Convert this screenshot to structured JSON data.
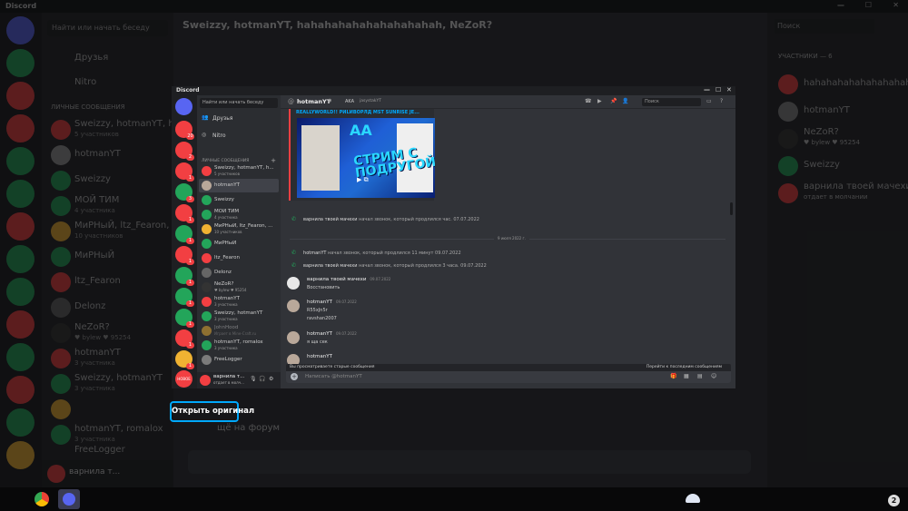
{
  "background": {
    "app_title": "Discord",
    "search_placeholder": "Найти или начать беседу",
    "header_title": "Sweizzy, hotmanYT, hahahahahahahahahahah, NeZoR?",
    "members_header": "УЧАСТНИКИ — 6",
    "search_label": "Поиск",
    "nav": [
      "Друзья",
      "Nitro"
    ],
    "dm_header": "ЛИЧНЫЕ СООБЩЕНИЯ",
    "dms": [
      {
        "name": "Sweizzy, hotmanYT, haha...",
        "sub": "5 участников"
      },
      {
        "name": "hotmanYT",
        "sub": ""
      },
      {
        "name": "Sweizzy",
        "sub": ""
      },
      {
        "name": "МОЙ ТИМ",
        "sub": "4 участника"
      },
      {
        "name": "МиРНыЙ, ltz_Fearon, ...",
        "sub": "10 участников"
      },
      {
        "name": "МиРНыЙ",
        "sub": ""
      },
      {
        "name": "ltz_Fearon",
        "sub": ""
      },
      {
        "name": "Delonz",
        "sub": ""
      },
      {
        "name": "NeZoR?",
        "sub": "♥ bylew ♥ 95254"
      },
      {
        "name": "hotmanYT",
        "sub": "3 участника"
      },
      {
        "name": "Sweizzy, hotmanYT",
        "sub": "3 участника"
      },
      {
        "name": "",
        "sub": ""
      },
      {
        "name": "hotmanYT, romalox",
        "sub": "3 участника"
      },
      {
        "name": "FreeLogger",
        "sub": ""
      }
    ],
    "members": [
      "hahahahahahahahahahah",
      "hotmanYT",
      "NeZoR?",
      "Sweizzy",
      "варнила твоей мачехи"
    ],
    "members_sub": [
      "",
      "",
      "♥ bylew ♥ 95254",
      "",
      "отдает в молчании"
    ],
    "user_name": "варнила т...",
    "chat_text": "щё на форум"
  },
  "popup": {
    "app_title": "Discord",
    "search_placeholder": "Найти или начать беседу",
    "nav": [
      "Друзья",
      "Nitro"
    ],
    "dm_header": "ЛИЧНЫЕ СООБЩЕНИЯ",
    "dms": [
      {
        "name": "Sweizzy, hotmanYT, h...",
        "sub": "5 участников"
      },
      {
        "name": "hotmanYT",
        "sub": ""
      },
      {
        "name": "Sweizzy",
        "sub": ""
      },
      {
        "name": "МОЙ ТИМ",
        "sub": "4 участника"
      },
      {
        "name": "МиРНыЙ, ltz_Fearon, ...",
        "sub": "10 участников"
      },
      {
        "name": "МиРНыЙ",
        "sub": ""
      },
      {
        "name": "ltz_Fearon",
        "sub": ""
      },
      {
        "name": "Delonz",
        "sub": ""
      },
      {
        "name": "NeZoR?",
        "sub": "♥ bylew ♥ 95254"
      },
      {
        "name": "hotmanYT",
        "sub": "3 участника"
      },
      {
        "name": "Sweizzy, hotmanYT",
        "sub": "3 участника"
      },
      {
        "name": "JohnHood",
        "sub": "Играет в Mine-Craft.ru"
      },
      {
        "name": "hotmanYT, romalox",
        "sub": "3 участника"
      },
      {
        "name": "FreeLogger",
        "sub": ""
      }
    ],
    "user": {
      "name": "варнила т...",
      "status": "отдает в молч..."
    },
    "header": {
      "name": "hotmanYT",
      "aka": "AKA",
      "aka_name": "јаѕуѕtakYT",
      "search": "Поиск"
    },
    "embed": {
      "title": "REALLYWORLD!! РИLИВОРЛД MST SUNRISE ЈЕ...",
      "thumb_aa": "AA",
      "thumb_title": "СТРИМ С ПОДРУГОЙ"
    },
    "calls": [
      {
        "user": "варнила твоей мачехи",
        "text": "начал звонок, который продлился час. 07.07.2022"
      },
      {
        "user": "hotmanYT",
        "text": "начал звонок, который продлился 11 минут 09.07.2022"
      },
      {
        "user": "варнила твоей мачехи",
        "text": "начал звонок, который продлился 3 часа. 09.07.2022"
      }
    ],
    "date_divider": "9 июля 2022 г.",
    "messages": [
      {
        "author": "варнила твоей мачехи",
        "date": "09.07.2022",
        "lines": [
          "Восстановить"
        ]
      },
      {
        "author": "hotmanYT",
        "date": "09.07.2022",
        "lines": [
          "R55xJn5r",
          "ravshan2007"
        ]
      },
      {
        "author": "hotmanYT",
        "date": "09.07.2022",
        "lines": [
          "я ща сек"
        ]
      },
      {
        "author": "hotmanYT",
        "date": "",
        "lines": []
      }
    ],
    "old_messages": "Вы просматриваете старые сообщения",
    "jump_label": "Перейти к последним сообщениям",
    "input_placeholder": "Написать @hotmanYT"
  },
  "open_original": "Открыть оригинал",
  "taskbar": {
    "badge": "2"
  },
  "colors": {
    "accent": "#00a8fc",
    "red": "#f23f42",
    "green": "#23a55a",
    "blurple": "#5865f2"
  }
}
